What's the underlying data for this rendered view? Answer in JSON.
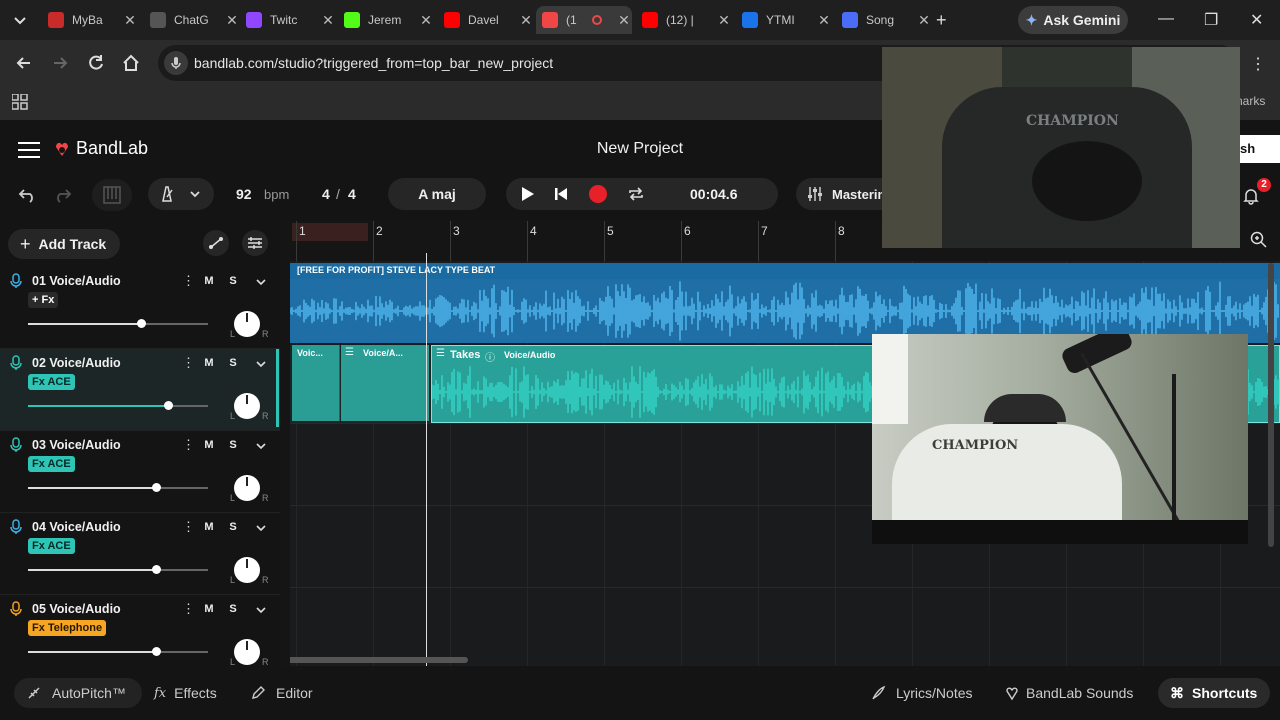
{
  "browser": {
    "tabs": [
      {
        "title": "MyBa",
        "icon": "m-logo-icon",
        "color": "#c92a2a"
      },
      {
        "title": "ChatG",
        "icon": "chatgpt-icon",
        "color": "#555555"
      },
      {
        "title": "Twitc",
        "icon": "twitch-icon",
        "color": "#9146ff"
      },
      {
        "title": "Jerem",
        "icon": "kick-icon",
        "color": "#53fc18"
      },
      {
        "title": "Davel",
        "icon": "youtube-icon",
        "color": "#ff0000"
      },
      {
        "title": "(1",
        "icon": "bandlab-icon",
        "color": "#f04646",
        "active": true,
        "recording": true
      },
      {
        "title": "(12) |",
        "icon": "youtube-icon",
        "color": "#ff0000"
      },
      {
        "title": "YTMI",
        "icon": "download-icon",
        "color": "#1a73e8"
      },
      {
        "title": "Song",
        "icon": "song-icon",
        "color": "#4a6cf7"
      }
    ],
    "ask_gemini": "Ask Gemini",
    "url": "bandlab.com/studio?triggered_from=top_bar_new_project",
    "bookmarks_partial": "narks"
  },
  "app": {
    "logo_text": "BandLab",
    "project_title": "New Project",
    "publish_partial": "sh",
    "notifications_count": "2",
    "transport": {
      "bpm_value": "92",
      "bpm_label": "bpm",
      "time_sig_num": "4",
      "time_sig_sep": "/",
      "time_sig_den": "4",
      "key": "A maj",
      "time": "00:04.6",
      "mastering": "Mastering"
    },
    "add_track": "Add Track",
    "tracks": [
      {
        "name": "01  Voice/Audio",
        "fx": "+ Fx",
        "fx_style": "plain",
        "mic_color": "#3ab0e6",
        "volume": 0.63
      },
      {
        "name": "02  Voice/Audio",
        "fx": "Fx ACE",
        "fx_style": "teal",
        "mic_color": "#2ec4b6",
        "volume": 0.78,
        "selected": true
      },
      {
        "name": "03  Voice/Audio",
        "fx": "Fx ACE",
        "fx_style": "teal",
        "mic_color": "#2ec4b6",
        "volume": 0.71
      },
      {
        "name": "04  Voice/Audio",
        "fx": "Fx ACE",
        "fx_style": "teal",
        "mic_color": "#3ab0e6",
        "volume": 0.71
      },
      {
        "name": "05  Voice/Audio",
        "fx": "Fx Telephone",
        "fx_style": "orange",
        "mic_color": "#f0a020",
        "volume": 0.71
      }
    ],
    "mute_label": "M",
    "solo_label": "S",
    "pan_left": "L",
    "pan_right": "R",
    "ruler_bars": [
      "1",
      "2",
      "3",
      "4",
      "5",
      "6",
      "7",
      "8"
    ],
    "clips": {
      "beat_title": "[FREE FOR PROFIT] STEVE LACY TYPE BEAT",
      "small_clip_1": "Voic...",
      "small_clip_2": "Voice/A...",
      "takes_label": "Takes",
      "takes_clip": "Voice/Audio"
    },
    "bottom": {
      "autopitch": "AutoPitch™",
      "effects": "Effects",
      "editor": "Editor",
      "lyrics": "Lyrics/Notes",
      "sounds": "BandLab Sounds",
      "shortcuts": "Shortcuts"
    }
  },
  "overlays": {
    "webcam_top_shirt_text": "CHAMPION",
    "webcam_bottom_shirt_text": "CHAMPION"
  }
}
